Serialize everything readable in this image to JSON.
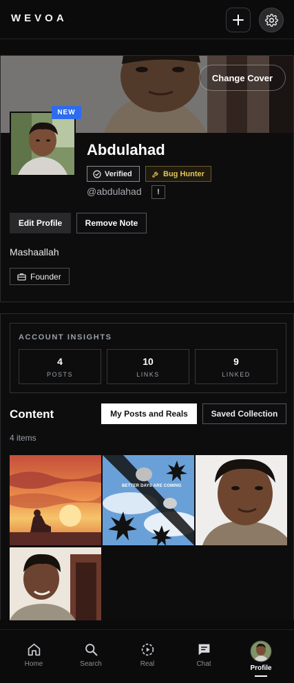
{
  "app": {
    "brand": "WEVOA"
  },
  "topbar": {
    "add_icon": "plus-icon",
    "settings_icon": "gear-icon"
  },
  "profile": {
    "change_cover_label": "Change Cover",
    "new_badge": "NEW",
    "name": "Abdulahad",
    "badges": {
      "verified": "Verified",
      "bug_hunter": "Bug Hunter"
    },
    "handle": "@abdulahad",
    "report_label": "!",
    "edit_label": "Edit Profile",
    "remove_note_label": "Remove Note",
    "bio": "Mashaallah",
    "role": "Founder",
    "colors": {
      "new_badge": "#2d6cf0",
      "bug_hunter": "#e6c45a"
    }
  },
  "insights": {
    "title": "ACCOUNT INSIGHTS",
    "stats": [
      {
        "value": "4",
        "label": "POSTS"
      },
      {
        "value": "10",
        "label": "LINKS"
      },
      {
        "value": "9",
        "label": "LINKED"
      }
    ]
  },
  "content": {
    "title": "Content",
    "tabs": {
      "active": "My Posts and Reals",
      "inactive": "Saved Collection"
    },
    "count": "4 items",
    "posts": [
      {
        "kind": "sunset-illustration"
      },
      {
        "kind": "flowers-sky",
        "caption": "BETTER DAYS ARE COMING"
      },
      {
        "kind": "portrait"
      },
      {
        "kind": "portrait-door"
      }
    ]
  },
  "nav": {
    "items": [
      {
        "label": "Home",
        "icon": "home-icon"
      },
      {
        "label": "Search",
        "icon": "search-icon"
      },
      {
        "label": "Real",
        "icon": "play-circle-icon"
      },
      {
        "label": "Chat",
        "icon": "chat-icon"
      },
      {
        "label": "Profile",
        "icon": "avatar"
      }
    ],
    "active": "Profile"
  }
}
